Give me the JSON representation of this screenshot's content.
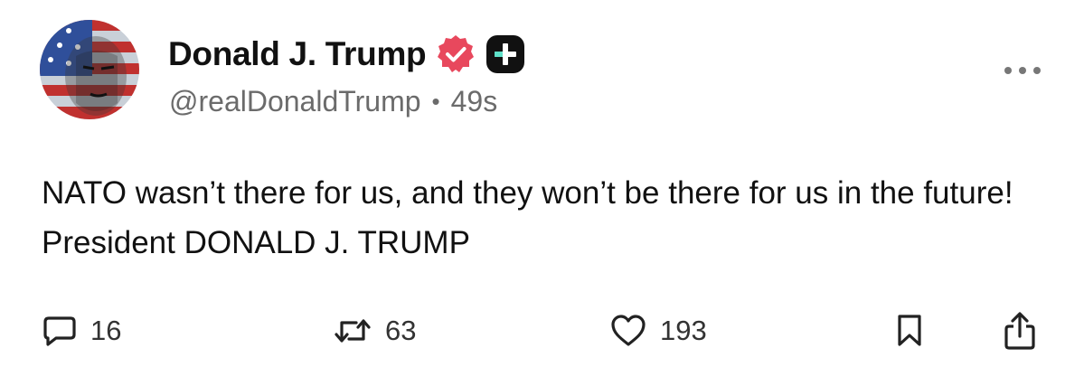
{
  "author": {
    "display_name": "Donald J. Trump",
    "handle": "@realDonaldTrump",
    "separator": "•",
    "timestamp": "49s",
    "verified": true,
    "verified_badge_color": "#e8485d",
    "plus_badge_color": "#111111",
    "plus_badge_accent": "#5ee0c8"
  },
  "post": {
    "text": "NATO wasn’t there for us, and they won’t be there for us in the future! President DONALD J. TRUMP"
  },
  "actions": {
    "reply_count": "16",
    "repost_count": "63",
    "like_count": "193"
  },
  "icons": {
    "reply": "speech-bubble-icon",
    "repost": "repost-arrows-icon",
    "like": "heart-icon",
    "bookmark": "bookmark-icon",
    "share": "share-icon",
    "more": "ellipsis-icon",
    "verified": "verified-badge-icon",
    "plus": "plus-badge-icon"
  }
}
